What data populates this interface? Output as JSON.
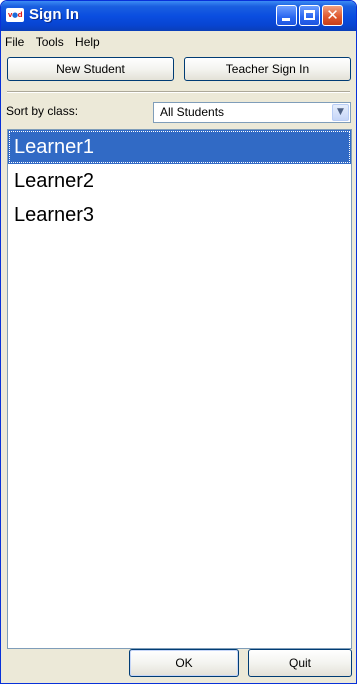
{
  "window": {
    "title": "Sign In",
    "icon": "app-logo-icon"
  },
  "menubar": {
    "items": [
      "File",
      "Tools",
      "Help"
    ]
  },
  "toolbar": {
    "new_student_label": "New Student",
    "teacher_sign_in_label": "Teacher Sign In"
  },
  "sort": {
    "label": "Sort by class:",
    "selected": "All Students"
  },
  "students": {
    "items": [
      "Learner1",
      "Learner2",
      "Learner3"
    ],
    "selected_index": 0
  },
  "footer": {
    "ok_label": "OK",
    "quit_label": "Quit"
  },
  "colors": {
    "titlebar": "#0a4ee0",
    "selection": "#316ac5",
    "window_bg": "#ece9d8"
  }
}
